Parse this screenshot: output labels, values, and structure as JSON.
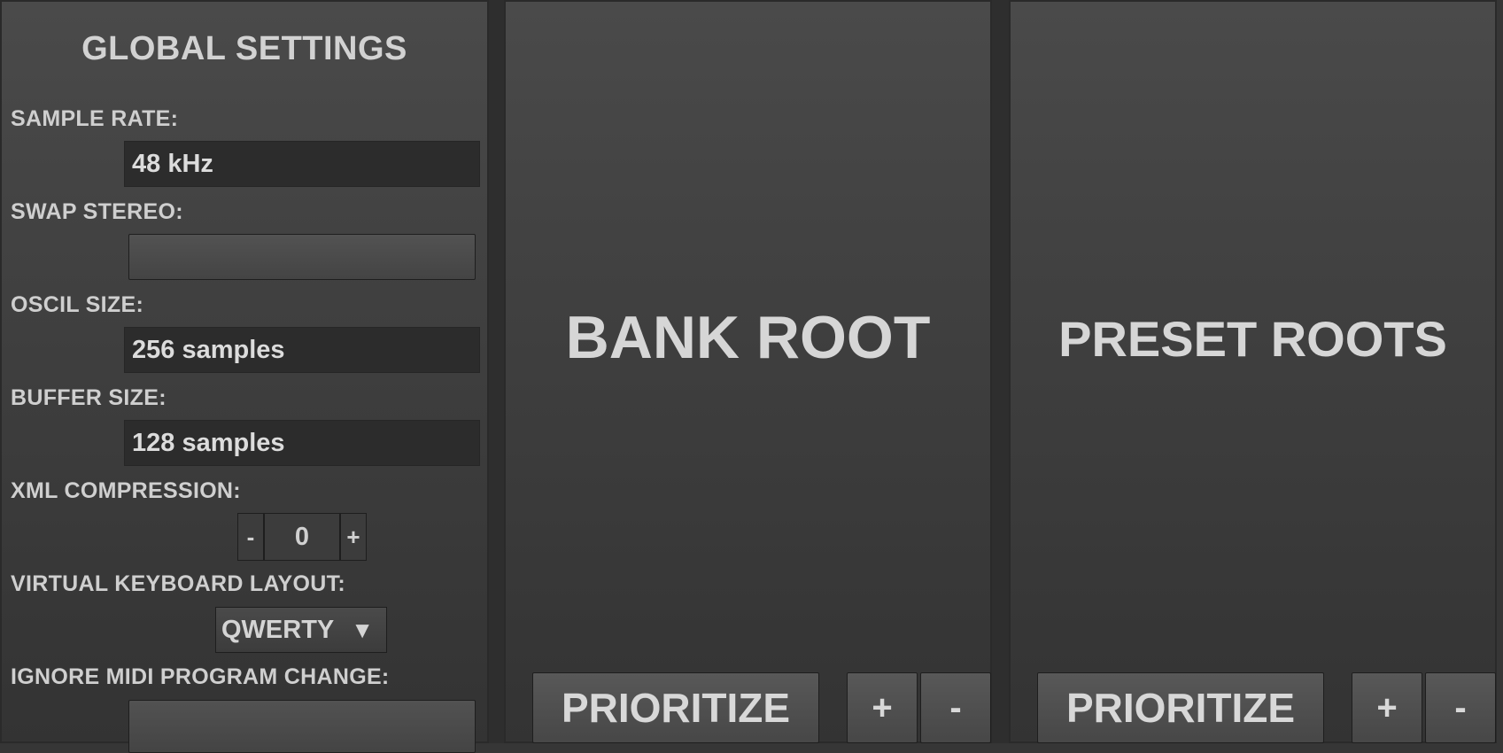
{
  "global": {
    "title": "GLOBAL SETTINGS",
    "sample_rate": {
      "label": "SAMPLE RATE:",
      "value": "48 kHz"
    },
    "swap_stereo": {
      "label": "SWAP STEREO:"
    },
    "oscil_size": {
      "label": "OSCIL SIZE:",
      "value": "256 samples"
    },
    "buffer_size": {
      "label": "BUFFER SIZE:",
      "value": "128 samples"
    },
    "xml_compression": {
      "label": "XML COMPRESSION:",
      "minus": "-",
      "value": "0",
      "plus": "+"
    },
    "keyboard_layout": {
      "label": "VIRTUAL KEYBOARD LAYOUT:",
      "value": "QWERTY",
      "arrow": "▼"
    },
    "ignore_midi": {
      "label": "IGNORE MIDI PROGRAM CHANGE:"
    }
  },
  "bank": {
    "title": "BANK ROOT",
    "prioritize": "PRIORITIZE",
    "add": "+",
    "remove": "-"
  },
  "preset": {
    "title": "PRESET ROOTS",
    "prioritize": "PRIORITIZE",
    "add": "+",
    "remove": "-"
  }
}
